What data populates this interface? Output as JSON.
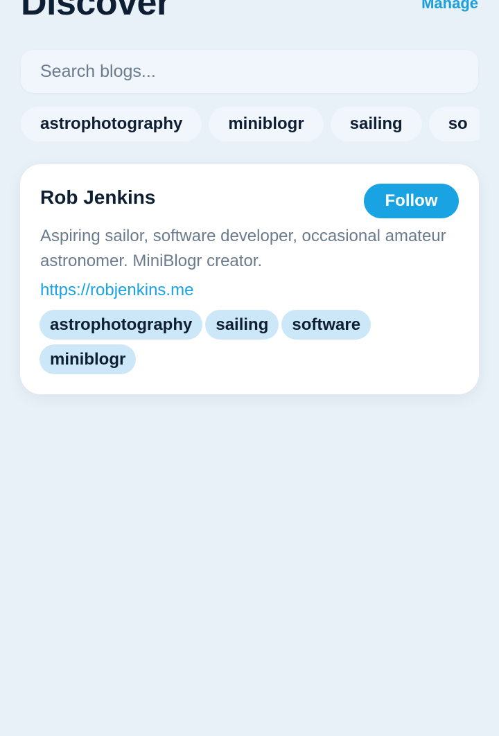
{
  "header": {
    "title": "Discover",
    "manage_label": "Manage"
  },
  "search": {
    "placeholder": "Search blogs...",
    "value": ""
  },
  "tag_filters": [
    "astrophotography",
    "miniblogr",
    "sailing",
    "so"
  ],
  "blogs": [
    {
      "name": "Rob Jenkins",
      "follow_label": "Follow",
      "bio": "Aspiring sailor, software developer, occasional amateur astronomer. MiniBlogr creator.",
      "url": "https://robjenkins.me",
      "tags": [
        "astrophotography",
        "sailing",
        "software",
        "miniblogr"
      ]
    }
  ],
  "colors": {
    "background": "#e8f0f8",
    "accent": "#1aa3e3",
    "tag_bg": "#cce8f8",
    "text": "#0f1f33",
    "muted": "#6b7b8e"
  }
}
